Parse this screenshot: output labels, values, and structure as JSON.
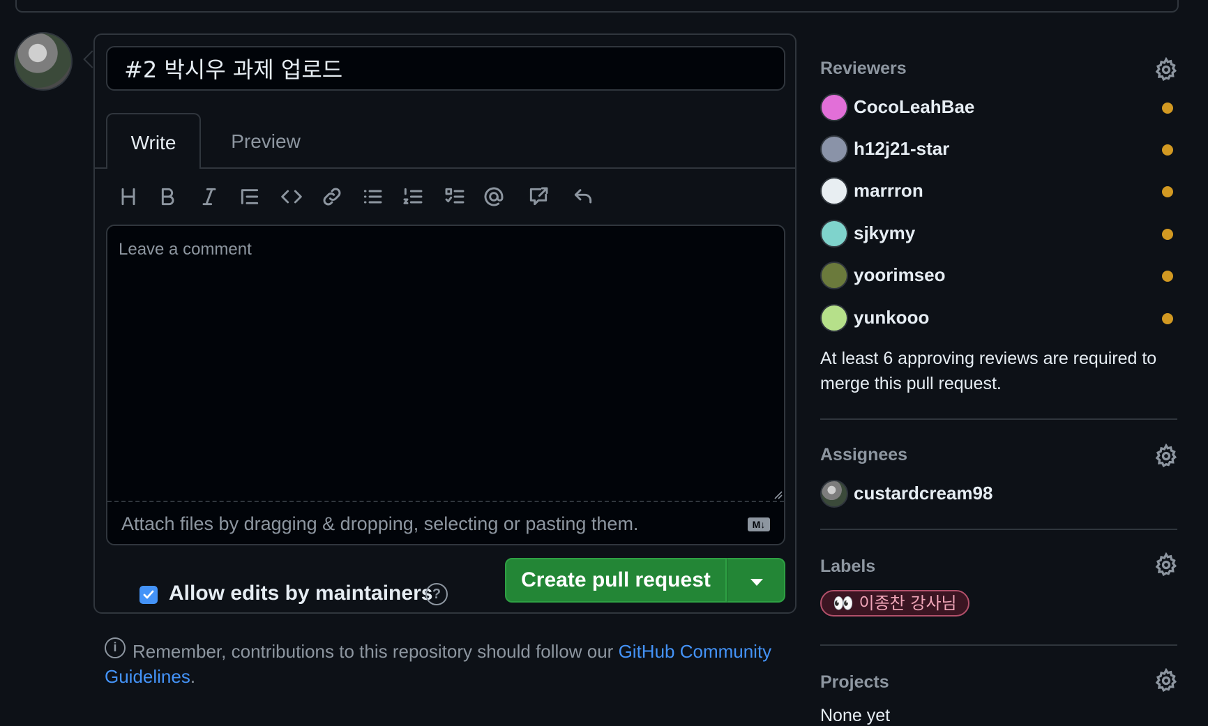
{
  "pr_form": {
    "title_value": "#2 박시우 과제 업로드",
    "tabs": {
      "write": "Write",
      "preview": "Preview"
    },
    "toolbar_icons": [
      "heading-icon",
      "bold-icon",
      "italic-icon",
      "quote-icon",
      "code-icon",
      "link-icon",
      "bulleted-list-icon",
      "numbered-list-icon",
      "task-list-icon",
      "mention-icon",
      "reference-icon",
      "undo-icon"
    ],
    "comment_placeholder": "Leave a comment",
    "attach_text": "Attach files by dragging & dropping, selecting or pasting them.",
    "markdown_badge": "M↓",
    "allow_edits_label": "Allow edits by maintainers",
    "allow_edits_checked": true,
    "help_glyph": "?",
    "create_button": "Create pull request",
    "remember_prefix": "Remember, contributions to this repository should follow our ",
    "remember_link": "GitHub Community Guidelines",
    "remember_suffix": ".",
    "info_glyph": "i"
  },
  "sidebar": {
    "reviewers": {
      "heading": "Reviewers",
      "items": [
        {
          "name": "CocoLeahBae",
          "status": "pending",
          "avatar_color": "#e26fd8"
        },
        {
          "name": "h12j21-star",
          "status": "pending",
          "avatar_color": "#8a93a8"
        },
        {
          "name": "marrron",
          "status": "pending",
          "avatar_color": "#e8eef2"
        },
        {
          "name": "sjkymy",
          "status": "pending",
          "avatar_color": "#7fd3cc"
        },
        {
          "name": "yoorimseo",
          "status": "pending",
          "avatar_color": "#6b7a3c"
        },
        {
          "name": "yunkooo",
          "status": "pending",
          "avatar_color": "#b6e08a"
        }
      ],
      "note": "At least 6 approving reviews are required to merge this pull request."
    },
    "assignees": {
      "heading": "Assignees",
      "items": [
        {
          "name": "custardcream98"
        }
      ]
    },
    "labels": {
      "heading": "Labels",
      "items": [
        {
          "name": "👀 이종찬 강사님",
          "color": "#b2506a"
        }
      ]
    },
    "projects": {
      "heading": "Projects",
      "value": "None yet"
    }
  },
  "colors": {
    "accent": "#4493f8",
    "success": "#238636",
    "pending": "#d29922",
    "bg": "#0d1117",
    "border": "#30363d"
  }
}
